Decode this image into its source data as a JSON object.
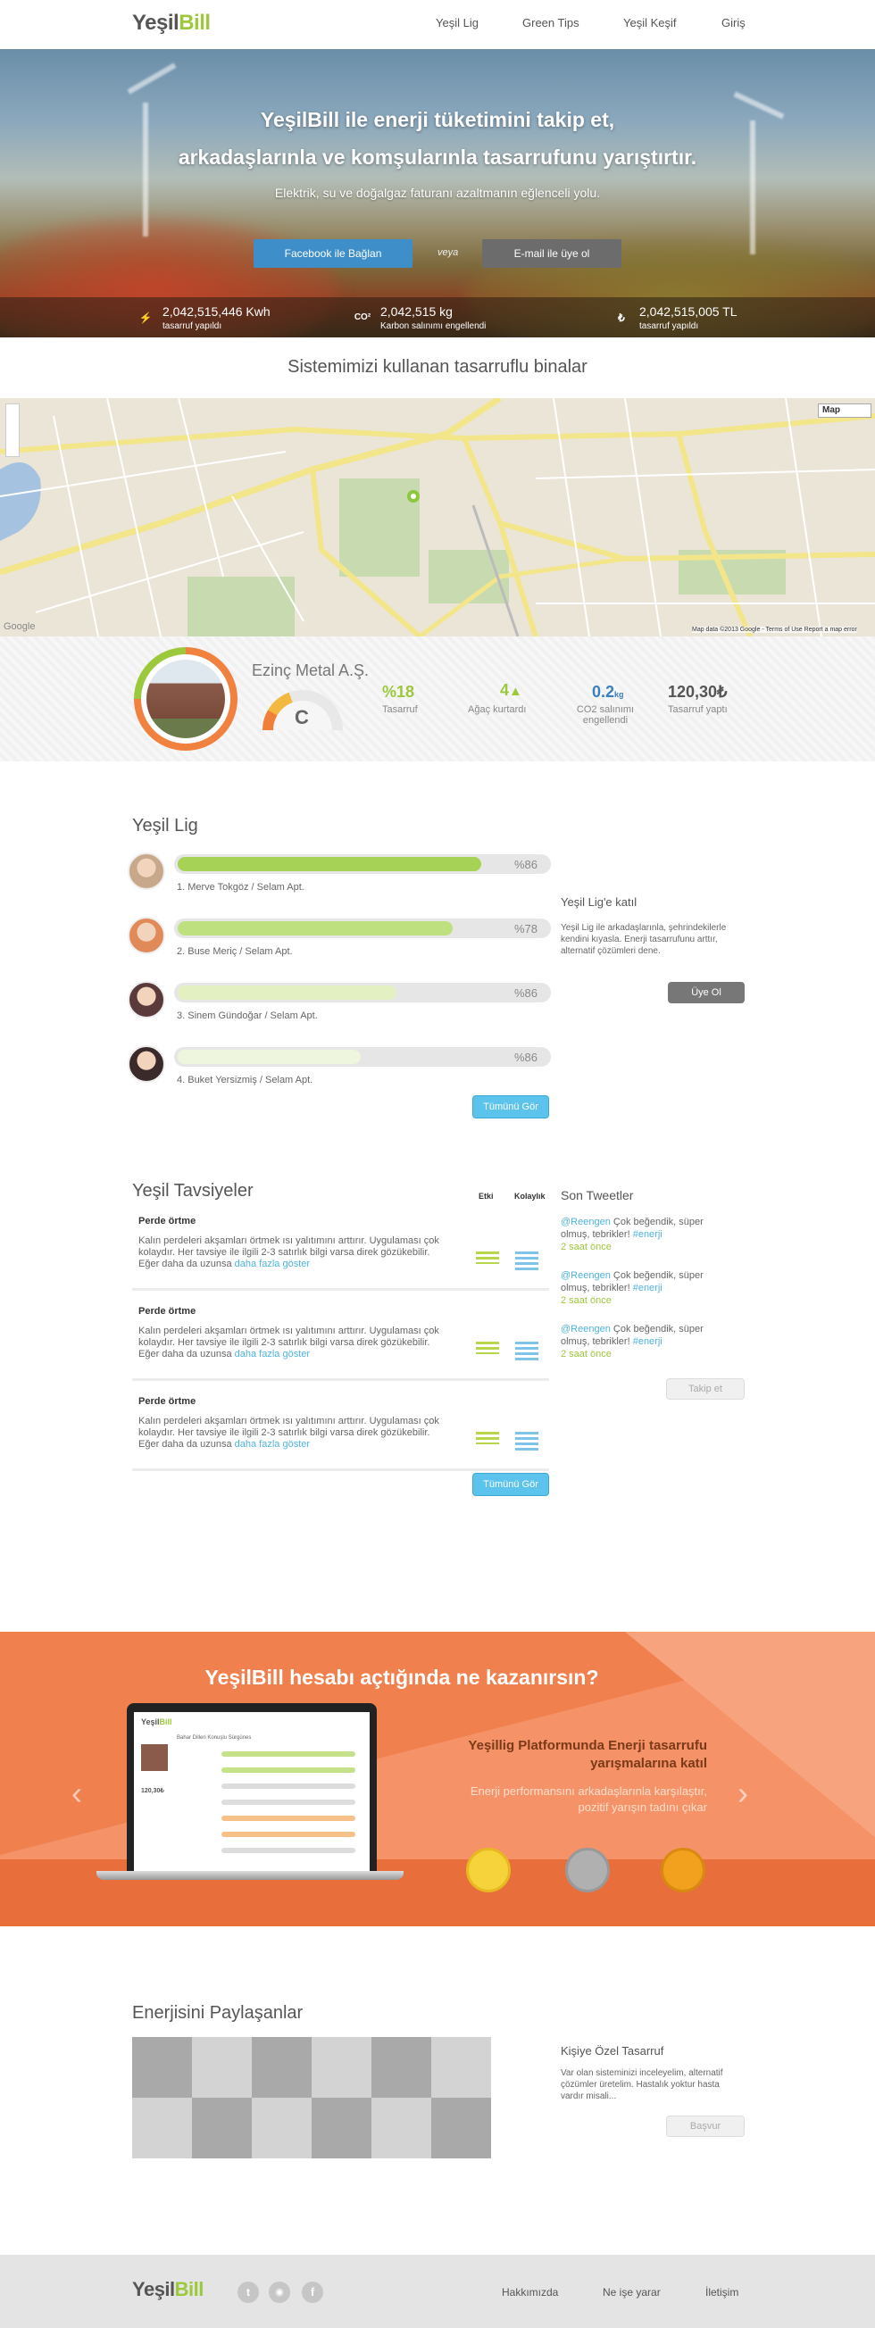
{
  "brand": {
    "logo_a": "Yeşil",
    "logo_b": "Bill"
  },
  "nav": [
    {
      "label": "Yeşil Lig"
    },
    {
      "label": "Green Tips"
    },
    {
      "label": "Yeşil Keşif"
    },
    {
      "label": "Giriş"
    }
  ],
  "hero": {
    "title_line1": "YeşilBill ile enerji tüketimini takip et,",
    "title_line2": "arkadaşlarınla ve komşularınla tasarrufunu yarıştırtır.",
    "subtitle": "Elektrik, su ve doğalgaz faturanı azaltmanın eğlenceli yolu.",
    "facebook_button": "Facebook ile Bağlan",
    "or_text": "veya",
    "email_button": "E-mail ile üye ol",
    "stats": [
      {
        "icon": "lightning-icon",
        "symbol": "⚡",
        "value": "2,042,515,446 Kwh",
        "label": "tasarruf yapıldı",
        "color": "#b59a3a"
      },
      {
        "icon": "co2-icon",
        "symbol": "CO²",
        "value": "2,042,515 kg",
        "label": "Karbon salınımı engellendi",
        "color": "#4d5a6a"
      },
      {
        "icon": "lira-icon",
        "symbol": "₺",
        "value": "2,042,515,005 TL",
        "label": "tasarruf yapıldı",
        "color": "#b59a3a"
      }
    ]
  },
  "buildings": {
    "title": "Sistemimizi kullanan tasarruflu binalar",
    "map_type": "Map",
    "map_credit": "Map data ©2013 Google - Terms of Use  Report a map error",
    "google": "Google"
  },
  "building": {
    "name": "Ezinç Metal A.Ş.",
    "grade": "C",
    "stats": [
      {
        "value": "%18",
        "label": "Tasarruf",
        "color": "#9cc83c"
      },
      {
        "value": "4",
        "label": "Ağaç kurtardı",
        "color": "#9cc83c",
        "icon": "tree-icon"
      },
      {
        "value": "0.2",
        "unit": "kg",
        "label": "CO2 salınımı engellendi",
        "color": "#3a7fbf"
      },
      {
        "value": "120,30₺",
        "label": "Tasarruf yaptı",
        "color": "#555"
      }
    ]
  },
  "league": {
    "title": "Yeşil Lig",
    "items": [
      {
        "name": "1. Merve Tokgöz / Selam Apt.",
        "pct": "%86",
        "fill": 0.86,
        "color": "#a6d255"
      },
      {
        "name": "2. Buse Meriç / Selam Apt.",
        "pct": "%78",
        "fill": 0.78,
        "color": "#bfe07e"
      },
      {
        "name": "3. Sinem Gündoğar / Selam Apt.",
        "pct": "%86",
        "fill": 0.62,
        "color": "#e3f1c2"
      },
      {
        "name": "4. Buket Yersizmiş / Selam Apt.",
        "pct": "%86",
        "fill": 0.52,
        "color": "#eef6dd"
      }
    ],
    "more": "Tümünü Gör",
    "join_title": "Yeşil Lig'e katıl",
    "join_text": "Yeşil Lig ile arkadaşlarınla, şehrindekilerle kendini kıyasla. Enerji tasarrufunu arttır, alternatif çözümleri dene.",
    "join_button": "Üye Ol"
  },
  "tips": {
    "title": "Yeşil Tavsiyeler",
    "col1": "Etki",
    "col2": "Kolaylık",
    "items": [
      {
        "title": "Perde örtme",
        "text": "Kalın perdeleri akşamları örtmek ısı yalıtımını arttırır. Uygulaması çok kolaydır. Her tavsiye ile ilgili 2-3 satırlık bilgi varsa direk gözükebilir. Eğer daha da uzunsa",
        "link": "daha fazla göster"
      },
      {
        "title": "Perde örtme",
        "text": "Kalın perdeleri akşamları örtmek ısı yalıtımını arttırır. Uygulaması çok kolaydır. Her tavsiye ile ilgili 2-3 satırlık bilgi varsa direk gözükebilir. Eğer daha da uzunsa",
        "link": "daha fazla göster"
      },
      {
        "title": "Perde örtme",
        "text": "Kalın perdeleri akşamları örtmek ısı yalıtımını arttırır. Uygulaması çok kolaydır. Her tavsiye ile ilgili 2-3 satırlık bilgi varsa direk gözükebilir. Eğer daha da uzunsa",
        "link": "daha fazla göster"
      }
    ],
    "more": "Tümünü Gör"
  },
  "tweets": {
    "title": "Son Tweetler",
    "items": [
      {
        "handle": "@Reengen",
        "text": "Çok beğendik, süper olmuş, tebrikler!",
        "tag": "#enerji",
        "time": "2 saat önce"
      },
      {
        "handle": "@Reengen",
        "text": "Çok beğendik, süper olmuş, tebrikler!",
        "tag": "#enerji",
        "time": "2 saat önce"
      },
      {
        "handle": "@Reengen",
        "text": "Çok beğendik, süper olmuş, tebrikler!",
        "tag": "#enerji",
        "time": "2 saat önce"
      }
    ],
    "follow": "Takip et"
  },
  "promo": {
    "title": "YeşilBill hesabı açtığında ne kazanırsın?",
    "heading": "Yeşillig Platformunda Enerji tasarrufu yarışmalarına katıl",
    "text": "Enerji performansını arkadaşlarınla karşılaştır, pozitif yarışın tadını çıkar",
    "prev": "‹",
    "next": "›",
    "screen_title": "Bahar Dilleri Konuşlu Sürgünes",
    "screen_value": "120,30₺"
  },
  "share": {
    "title": "Enerjisini Paylaşanlar",
    "side_title": "Kişiye Özel Tasarruf",
    "side_text": "Var olan sisteminizi inceleyelim, alternatif çözümler üretelim. Hastalık yoktur hasta vardır misali...",
    "apply": "Başvur"
  },
  "footer": {
    "links": [
      "Hakkımızda",
      "Ne işe yarar",
      "İletişim"
    ],
    "social": [
      "twitter-icon",
      "rss-icon",
      "facebook-icon"
    ]
  }
}
